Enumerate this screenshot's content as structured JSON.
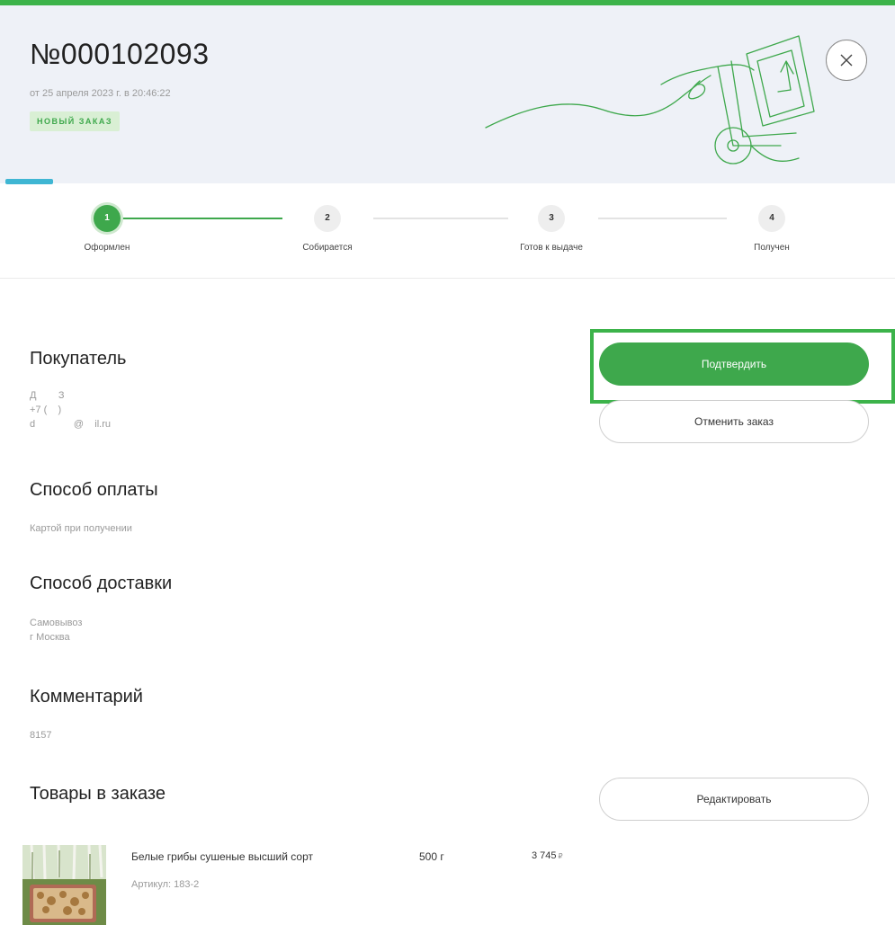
{
  "order": {
    "number": "№000102093",
    "date": "от 25 апреля 2023 г. в 20:46:22",
    "status": "НОВЫЙ ЗАКАЗ",
    "progress_fraction": 0.05
  },
  "steps": [
    {
      "number": "1",
      "label": "Оформлен",
      "active": true
    },
    {
      "number": "2",
      "label": "Собирается",
      "active": false
    },
    {
      "number": "3",
      "label": "Готов к выдаче",
      "active": false
    },
    {
      "number": "4",
      "label": "Получен",
      "active": false
    }
  ],
  "buyer": {
    "title": "Покупатель",
    "name": "Д        З",
    "phone": "+7 (    )",
    "email": "d              @    il.ru"
  },
  "actions": {
    "confirm_label": "Подтвердить",
    "cancel_label": "Отменить заказ",
    "edit_label": "Редактировать"
  },
  "payment": {
    "title": "Способ оплаты",
    "method": "Картой при получении"
  },
  "delivery": {
    "title": "Способ доставки",
    "method": "Самовывоз",
    "city": "г Москва"
  },
  "comment": {
    "title": "Комментарий",
    "text": "8157"
  },
  "items": {
    "title": "Товары в заказе",
    "list": [
      {
        "name": "Белые грибы сушеные высший сорт",
        "sku": "Артикул: 183-2",
        "weight": "500 г",
        "price": "3 745",
        "currency": "₽"
      }
    ]
  },
  "colors": {
    "accent": "#3ea84c",
    "header_bg": "#eef1f7",
    "progress": "#3fb6d3",
    "badge_bg": "#d9efd4"
  },
  "icons": {
    "close": "close-icon",
    "header_illustration": "hand-truck-illustration"
  }
}
